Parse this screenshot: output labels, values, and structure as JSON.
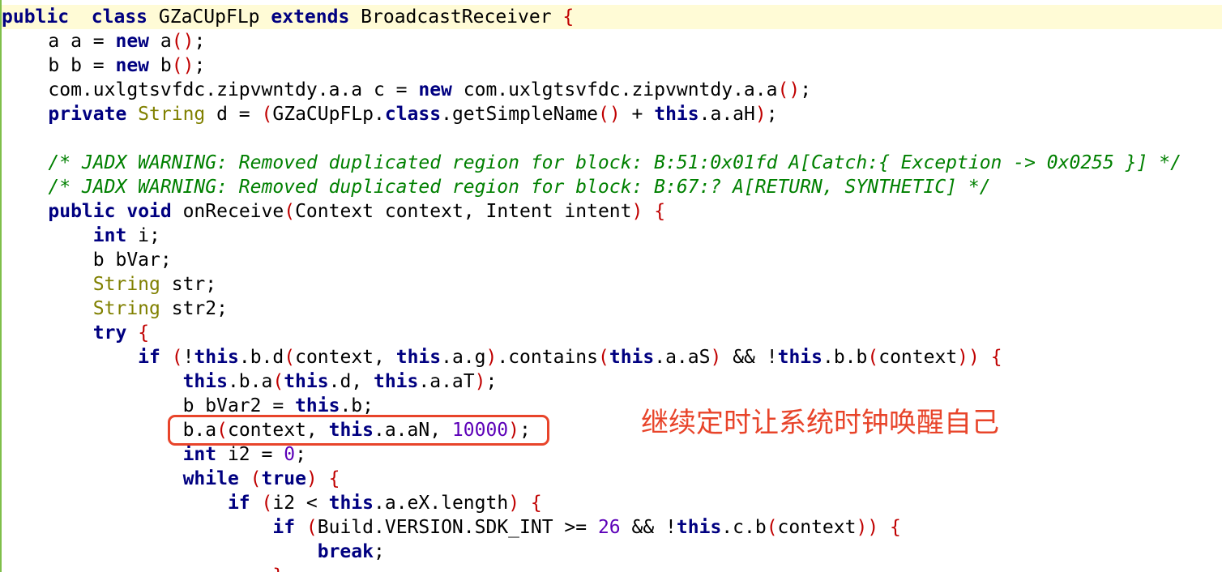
{
  "editor": {
    "lines": [
      [
        [
          "kw",
          "public"
        ],
        [
          "",
          "  "
        ],
        [
          "kw",
          "class"
        ],
        [
          "",
          " GZaCUpFLp "
        ],
        [
          "kw",
          "extends"
        ],
        [
          "",
          " BroadcastReceiver "
        ],
        [
          "br",
          "{"
        ]
      ],
      [
        [
          "",
          " a a = "
        ],
        [
          "kw",
          "new"
        ],
        [
          "",
          " a"
        ],
        [
          "br",
          "()"
        ],
        [
          "",
          ";"
        ]
      ],
      [
        [
          "",
          " b b = "
        ],
        [
          "kw",
          "new"
        ],
        [
          "",
          " b"
        ],
        [
          "br",
          "()"
        ],
        [
          "",
          ";"
        ]
      ],
      [
        [
          "",
          " com.uxlgtsvfdc.zipvwntdy.a.a c = "
        ],
        [
          "kw",
          "new"
        ],
        [
          "",
          " com.uxlgtsvfdc.zipvwntdy.a.a"
        ],
        [
          "br",
          "()"
        ],
        [
          "",
          ";"
        ]
      ],
      [
        [
          "kw",
          " private"
        ],
        [
          "",
          ""
        ],
        [
          "tp",
          " String"
        ],
        [
          "",
          " d = "
        ],
        [
          "br",
          "("
        ],
        [
          "",
          "GZaCUpFLp."
        ],
        [
          "kw",
          "class"
        ],
        [
          "",
          ".getSimpleName"
        ],
        [
          "br",
          "()"
        ],
        [
          "",
          " + "
        ],
        [
          "kw",
          "this"
        ],
        [
          "",
          ".a.aH"
        ],
        [
          "br",
          ")"
        ],
        [
          "",
          ";"
        ]
      ],
      [],
      [
        [
          "cm",
          " /* JADX WARNING: Removed duplicated region for block: B:51:0x01fd A[Catch:{ Exception -> 0x0255 }] */"
        ]
      ],
      [
        [
          "cm",
          " /* JADX WARNING: Removed duplicated region for block: B:67:? A[RETURN, SYNTHETIC] */"
        ]
      ],
      [
        [
          "kw",
          " public"
        ],
        [
          "",
          " "
        ],
        [
          "kw",
          "void"
        ],
        [
          "",
          " onReceive"
        ],
        [
          "br",
          "("
        ],
        [
          "",
          "Context context, Intent intent"
        ],
        [
          "br",
          ")"
        ],
        [
          "",
          " "
        ],
        [
          "br",
          "{"
        ]
      ],
      [
        [
          "kw",
          " int"
        ],
        [
          "",
          " i;"
        ]
      ],
      [
        [
          "",
          " b bVar;"
        ]
      ],
      [
        [
          "tp",
          " String"
        ],
        [
          "",
          " str;"
        ]
      ],
      [
        [
          "tp",
          " String"
        ],
        [
          "",
          " str2;"
        ]
      ],
      [
        [
          "kw",
          " try"
        ],
        [
          "",
          " "
        ],
        [
          "br",
          "{"
        ]
      ],
      [
        [
          "kw",
          " if"
        ],
        [
          "",
          " "
        ],
        [
          "br",
          "("
        ],
        [
          "",
          "!"
        ],
        [
          "kw",
          "this"
        ],
        [
          "",
          ".b.d"
        ],
        [
          "br",
          "("
        ],
        [
          "",
          "context, "
        ],
        [
          "kw",
          "this"
        ],
        [
          "",
          ".a.g"
        ],
        [
          "br",
          ")"
        ],
        [
          "",
          ".contains"
        ],
        [
          "br",
          "("
        ],
        [
          "kw",
          "this"
        ],
        [
          "",
          ".a.aS"
        ],
        [
          "br",
          ")"
        ],
        [
          "",
          " && !"
        ],
        [
          "kw",
          "this"
        ],
        [
          "",
          ".b.b"
        ],
        [
          "br",
          "("
        ],
        [
          "",
          "context"
        ],
        [
          "br",
          "))"
        ],
        [
          "",
          " "
        ],
        [
          "br",
          "{"
        ]
      ],
      [
        [
          "kw",
          " this"
        ],
        [
          "",
          ".b.a"
        ],
        [
          "br",
          "("
        ],
        [
          "kw",
          "this"
        ],
        [
          "",
          ".d, "
        ],
        [
          "kw",
          "this"
        ],
        [
          "",
          ".a.aT"
        ],
        [
          "br",
          ")"
        ],
        [
          "",
          ";"
        ]
      ],
      [
        [
          "",
          " b bVar2 = "
        ],
        [
          "kw",
          "this"
        ],
        [
          "",
          ".b;"
        ]
      ],
      [
        [
          "",
          " b.a"
        ],
        [
          "br",
          "("
        ],
        [
          "",
          "context, "
        ],
        [
          "kw",
          "this"
        ],
        [
          "",
          ".a.aN, "
        ],
        [
          "nm",
          "10000"
        ],
        [
          "br",
          ")"
        ],
        [
          "",
          ";"
        ]
      ],
      [
        [
          "kw",
          " int"
        ],
        [
          "",
          " i2 = "
        ],
        [
          "nm",
          "0"
        ],
        [
          "",
          ";"
        ]
      ],
      [
        [
          "kw",
          " while"
        ],
        [
          "",
          " "
        ],
        [
          "br",
          "("
        ],
        [
          "kw",
          "true"
        ],
        [
          "br",
          ")"
        ],
        [
          "",
          " "
        ],
        [
          "br",
          "{"
        ]
      ],
      [
        [
          "kw",
          " if"
        ],
        [
          "",
          " "
        ],
        [
          "br",
          "("
        ],
        [
          "",
          "i2 < "
        ],
        [
          "kw",
          "this"
        ],
        [
          "",
          ".a.eX.length"
        ],
        [
          "br",
          ")"
        ],
        [
          "",
          " "
        ],
        [
          "br",
          "{"
        ]
      ],
      [
        [
          "kw",
          " if"
        ],
        [
          "",
          " "
        ],
        [
          "br",
          "("
        ],
        [
          "",
          "Build.VERSION.SDK_INT >= "
        ],
        [
          "nm",
          "26"
        ],
        [
          "",
          " && !"
        ],
        [
          "kw",
          "this"
        ],
        [
          "",
          ".c.b"
        ],
        [
          "br",
          "("
        ],
        [
          "",
          "context"
        ],
        [
          "br",
          "))"
        ],
        [
          "",
          " "
        ],
        [
          "br",
          "{"
        ]
      ],
      [
        [
          "kw",
          " break"
        ],
        [
          "",
          ";"
        ]
      ],
      [
        [
          "br",
          " }"
        ]
      ]
    ],
    "indents": [
      0,
      1,
      1,
      1,
      1,
      0,
      1,
      1,
      1,
      2,
      2,
      2,
      2,
      2,
      3,
      4,
      4,
      4,
      4,
      4,
      5,
      6,
      7,
      6
    ]
  },
  "annotation": {
    "text": "继续定时让系统时钟唤醒自己"
  }
}
